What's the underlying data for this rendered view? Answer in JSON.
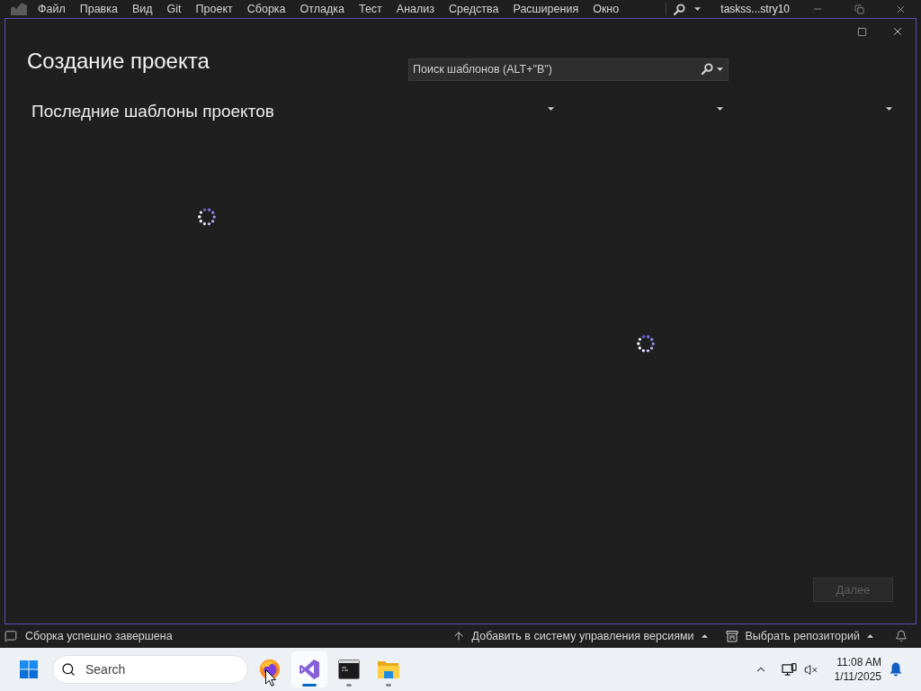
{
  "menu_bar": {
    "items": [
      "Файл",
      "Правка",
      "Вид",
      "Git",
      "Проект",
      "Сборка",
      "Отладка",
      "Тест",
      "Анализ",
      "Средства",
      "Расширения",
      "Окно"
    ],
    "window_title": "taskss...stry10"
  },
  "dialog": {
    "title": "Создание проекта",
    "search": {
      "placeholder": "Поиск шаблонов (ALT+\"В\")"
    },
    "recent_templates": {
      "heading": "Последние шаблоны проектов",
      "loading": true
    },
    "filters": [
      {
        "kind": "dropdown"
      },
      {
        "kind": "dropdown"
      },
      {
        "kind": "dropdown"
      }
    ],
    "template_list": {
      "loading": true
    },
    "next_button": {
      "label": "Далее",
      "disabled": true
    }
  },
  "status_bar": {
    "message": "Сборка успешно завершена",
    "items": [
      {
        "kind": "source-control",
        "label": "Добавить в систему управления версиями"
      },
      {
        "kind": "repository",
        "label": "Выбрать репозиторий"
      }
    ]
  },
  "taskbar": {
    "search_placeholder": "Search",
    "apps": [
      {
        "kind": "browser",
        "open": false,
        "selected": false
      },
      {
        "kind": "ide",
        "open": true,
        "selected": true
      },
      {
        "kind": "terminal",
        "open": true,
        "selected": false
      },
      {
        "kind": "folder",
        "open": true,
        "selected": false
      }
    ],
    "time": "11:08 AM",
    "date": "1/11/2025"
  }
}
